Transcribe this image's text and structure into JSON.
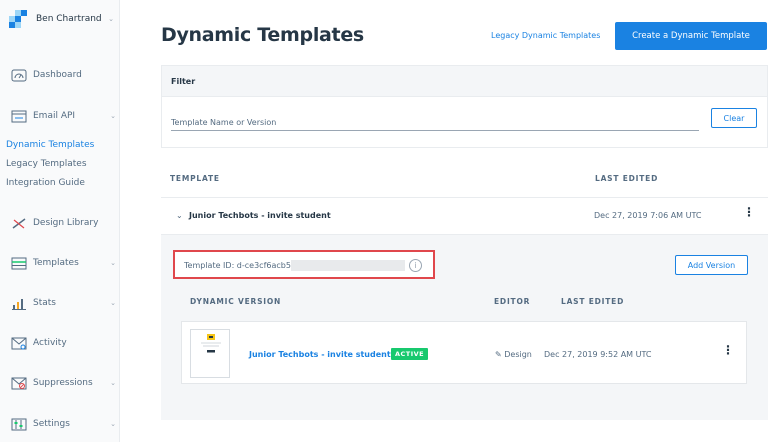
{
  "sidebar": {
    "account_name": "Ben Chartrand",
    "items": [
      {
        "label": "Dashboard",
        "icon": "dashboard-icon",
        "chevron": false
      },
      {
        "label": "Email API",
        "icon": "email-api-icon",
        "chevron": true
      },
      {
        "label": "Design Library",
        "icon": "design-library-icon",
        "chevron": false
      },
      {
        "label": "Templates",
        "icon": "templates-icon",
        "chevron": true
      },
      {
        "label": "Stats",
        "icon": "stats-icon",
        "chevron": true
      },
      {
        "label": "Activity",
        "icon": "activity-icon",
        "chevron": false
      },
      {
        "label": "Suppressions",
        "icon": "suppressions-icon",
        "chevron": true
      },
      {
        "label": "Settings",
        "icon": "settings-icon",
        "chevron": true
      }
    ],
    "email_api_subitems": [
      "Dynamic Templates",
      "Legacy Templates",
      "Integration Guide"
    ],
    "active_subitem": "Dynamic Templates",
    "accent_color": "#1a82e2"
  },
  "header": {
    "title": "Dynamic Templates",
    "legacy_link": "Legacy Dynamic Templates",
    "create_button": "Create a Dynamic Template"
  },
  "filter": {
    "title": "Filter",
    "placeholder": "Template Name or Version",
    "clear_button": "Clear"
  },
  "table": {
    "col_template": "TEMPLATE",
    "col_last_edited": "LAST EDITED",
    "row": {
      "name": "Junior Techbots - invite student",
      "last_edited": "Dec 27, 2019 7:06 AM UTC",
      "template_id_label": "Template ID: d-ce3cf6acb5",
      "add_version_button": "Add Version",
      "versions_header": {
        "dynamic_version": "DYNAMIC VERSION",
        "editor": "EDITOR",
        "last_edited": "LAST EDITED"
      },
      "versions": [
        {
          "name": "Junior Techbots - invite students",
          "status": "ACTIVE",
          "editor": "Design",
          "last_edited": "Dec 27, 2019 9:52 AM UTC"
        }
      ]
    }
  },
  "colors": {
    "primary": "#1a82e2",
    "active_badge": "#18c96e",
    "highlight_box": "#e0474c"
  }
}
